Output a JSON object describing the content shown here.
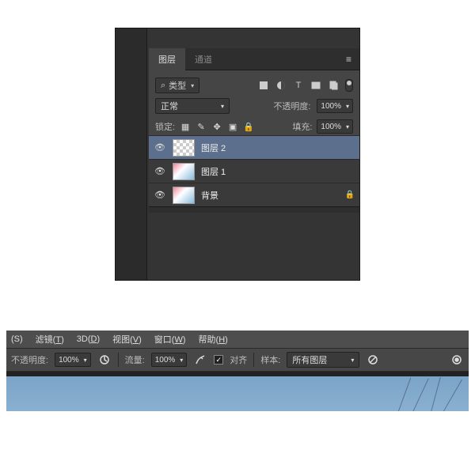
{
  "layersPanel": {
    "tabs": {
      "layers": "图层",
      "channels": "通道"
    },
    "filter": {
      "kindLabel": "类型"
    },
    "blend": {
      "mode": "正常",
      "opacityLabel": "不透明度:",
      "opacityValue": "100%"
    },
    "lock": {
      "label": "锁定:",
      "fillLabel": "填充:",
      "fillValue": "100%"
    },
    "layers": [
      {
        "name": "图层 2",
        "thumbType": "checker",
        "selected": true,
        "locked": false
      },
      {
        "name": "图层 1",
        "thumbType": "img",
        "selected": false,
        "locked": false
      },
      {
        "name": "背景",
        "thumbType": "img",
        "selected": false,
        "locked": true
      }
    ]
  },
  "menuBar": {
    "items": [
      {
        "text": "(S)",
        "key": ""
      },
      {
        "text": "滤镜",
        "key": "T"
      },
      {
        "text": "3D",
        "key": "D"
      },
      {
        "text": "视图",
        "key": "V"
      },
      {
        "text": "窗口",
        "key": "W"
      },
      {
        "text": "帮助",
        "key": "H"
      }
    ]
  },
  "optionsBar": {
    "opacityLabel": "不透明度:",
    "opacityValue": "100%",
    "flowLabel": "流量:",
    "flowValue": "100%",
    "alignLabel": "对齐",
    "sampleLabel": "样本:",
    "sampleValue": "所有图层"
  }
}
